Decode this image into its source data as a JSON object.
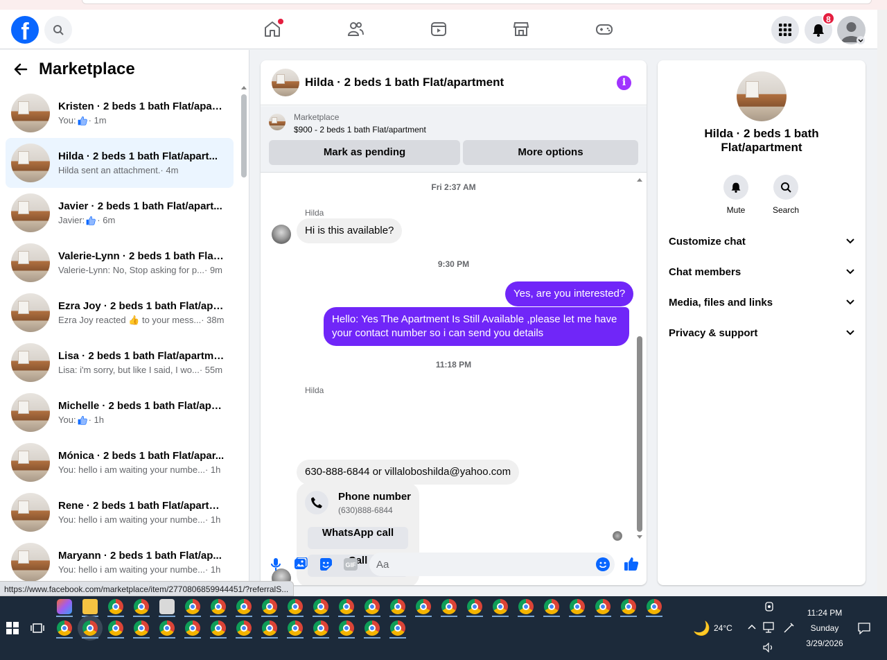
{
  "browser": {
    "status_url": "https://www.facebook.com/marketplace/item/2770806859944451/?referralS..."
  },
  "nav": {
    "logo": "f",
    "notifications_count": "8"
  },
  "sidebar": {
    "title": "Marketplace",
    "conversations": [
      {
        "title": "Kristen · 2 beds 1 bath Flat/apart...",
        "preview": "You: ",
        "like": true,
        "time": " · 1m"
      },
      {
        "title": "Hilda · 2 beds 1 bath Flat/apart...",
        "preview": "Hilda sent an attachment.",
        "like": false,
        "time": " · 4m"
      },
      {
        "title": "Javier · 2 beds 1 bath Flat/apart...",
        "preview": "Javier: ",
        "like": true,
        "time": " · 6m"
      },
      {
        "title": "Valerie-Lynn · 2 beds 1 bath Flat/...",
        "preview": "Valerie-Lynn: No, Stop asking for p...",
        "like": false,
        "time": " · 9m"
      },
      {
        "title": "Ezra Joy · 2 beds 1 bath Flat/apa...",
        "preview": "Ezra Joy reacted 👍 to your mess...",
        "like": false,
        "time": " · 38m"
      },
      {
        "title": "Lisa · 2 beds 1 bath Flat/apartme...",
        "preview": "Lisa: i'm sorry, but like I said, I wo...",
        "like": false,
        "time": " · 55m"
      },
      {
        "title": "Michelle · 2 beds 1 bath Flat/apa...",
        "preview": "You: ",
        "like": true,
        "time": " · 1h"
      },
      {
        "title": "Mónica · 2 beds 1 bath Flat/apar...",
        "preview": "You: hello i am waiting your numbe...",
        "like": false,
        "time": " · 1h"
      },
      {
        "title": "Rene · 2 beds 1 bath Flat/apartm...",
        "preview": "You: hello i am waiting your numbe...",
        "like": false,
        "time": " · 1h"
      },
      {
        "title": "Maryann · 2 beds 1 bath Flat/ap...",
        "preview": "You: hello i am waiting your numbe...",
        "like": false,
        "time": " · 1h"
      }
    ]
  },
  "chat": {
    "title": "Hilda · 2 beds 1 bath Flat/apartment",
    "listing_source": "Marketplace",
    "listing_price": "$900 - 2 beds 1 bath Flat/apartment",
    "btn_pending": "Mark as pending",
    "btn_more": "More options",
    "ts1": "Fri 2:37 AM",
    "sender": "Hilda",
    "msg1": "Hi is this available?",
    "ts2": "9:30 PM",
    "msg2": "Yes, are you interested?",
    "msg3": "Hello: Yes The Apartment Is Still Available ,please let me have your contact number so i can send you details",
    "ts3": "11:18 PM",
    "msg4": "630-888-6844  or villaloboshilda@yahoo.com",
    "card_title": "Phone number",
    "card_number": "(630)888-6844",
    "card_btn_whatsapp": "WhatsApp call",
    "card_btn_call": "Call",
    "input_placeholder": "Aa"
  },
  "details": {
    "title": "Hilda · 2 beds 1 bath Flat/apartment",
    "mute": "Mute",
    "search": "Search",
    "rows": [
      "Customize chat",
      "Chat members",
      "Media, files and links",
      "Privacy & support"
    ]
  },
  "taskbar": {
    "temperature": "24°C",
    "time": "11:24 PM",
    "day": "Sunday",
    "date": "3/29/2026"
  },
  "colors": {
    "brand": "#0866ff",
    "outgoing": "#7026f8",
    "active_row": "#ebf5ff"
  }
}
